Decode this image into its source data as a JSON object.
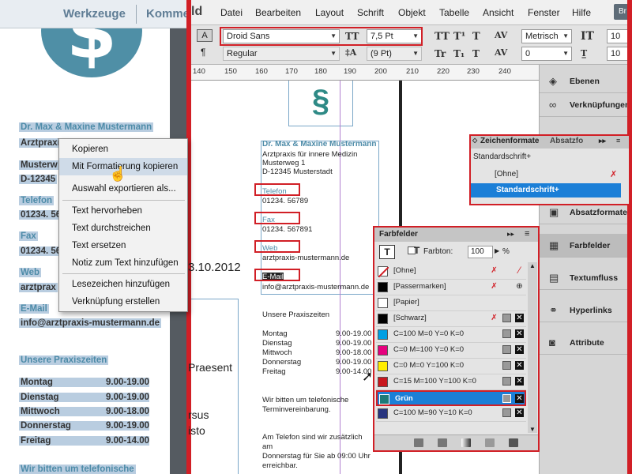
{
  "left_panel": {
    "workspace_1": "Werkzeuge",
    "workspace_2": "Komme",
    "logo_glyph": "$",
    "lines": [
      {
        "text": "Dr. Max & Maxine Mustermann",
        "style": "title"
      },
      {
        "text": "Arztpraxis",
        "style": "plain"
      },
      {
        "text": "Musterw",
        "style": "plain"
      },
      {
        "text": "D-12345",
        "style": "plain"
      },
      {
        "text": "Telefon",
        "style": "head"
      },
      {
        "text": "01234. 56",
        "style": "plain"
      },
      {
        "text": "Fax",
        "style": "head"
      },
      {
        "text": "01234. 56",
        "style": "plain"
      },
      {
        "text": "Web",
        "style": "head"
      },
      {
        "text": "arztprax",
        "style": "plain"
      },
      {
        "text": "E-Mail",
        "style": "head"
      },
      {
        "text": "info@arztpraxis-mustermann.de",
        "style": "plain"
      },
      {
        "text": "Unsere Praxiszeiten",
        "style": "head"
      }
    ],
    "hours": [
      {
        "day": "Montag",
        "time": "9.00-19.00"
      },
      {
        "day": "Dienstag",
        "time": "9.00-19.00"
      },
      {
        "day": "Mittwoch",
        "time": "9.00-18.00"
      },
      {
        "day": "Donnerstag",
        "time": "9.00-19.00"
      },
      {
        "day": "Freitag",
        "time": "9.00-14.00"
      }
    ],
    "footer_text": "Wir bitten um telefonische"
  },
  "menubar": {
    "app_fragment": "ld",
    "items": [
      "Datei",
      "Bearbeiten",
      "Layout",
      "Schrift",
      "Objekt",
      "Tabelle",
      "Ansicht",
      "Fenster",
      "Hilfe"
    ],
    "bridge": "Br"
  },
  "control_panel": {
    "font_family": "Droid Sans",
    "font_style": "Regular",
    "font_size": "7,5 Pt",
    "leading": "(9 Pt)",
    "kerning": "Metrisch",
    "tracking": "0",
    "scale_vertical": "10",
    "scale_horizontal": "10",
    "char_mode_label": "A",
    "para_mode_label": "¶"
  },
  "ruler": {
    "ticks": [
      "140",
      "150",
      "160",
      "170",
      "180",
      "190",
      "200",
      "210",
      "220",
      "230",
      "240"
    ]
  },
  "document": {
    "logo_glyph": "§",
    "title": "Dr. Max & Maxine Mustermann",
    "address": [
      "Arztpraxis für innere Medizin",
      "Musterweg 1",
      "D-12345 Musterstadt"
    ],
    "telefon_label": "Telefon",
    "telefon": "01234. 56789",
    "fax_label": "Fax",
    "fax": "01234. 567891",
    "web_label": "Web",
    "web": "arztpraxis-mustermann.de",
    "email_label": "E-Mail",
    "email": "info@arztpraxis-mustermann.de",
    "hours_title": "Unsere Praxiszeiten",
    "hours": [
      {
        "day": "Montag",
        "time": "9.00-19.00"
      },
      {
        "day": "Dienstag",
        "time": "9.00-19.00"
      },
      {
        "day": "Mittwoch",
        "time": "9.00-18.00"
      },
      {
        "day": "Donnerstag",
        "time": "9.00-19.00"
      },
      {
        "day": "Freitag",
        "time": "9.00-14.00"
      }
    ],
    "note_lines": [
      "Wir bitten um telefonische",
      "Terminvereinbarung."
    ],
    "phone_note_lines": [
      "Am Telefon sind wir zusätzlich",
      "am",
      "Donnerstag für Sie ab 09:00 Uhr",
      "erreichbar."
    ]
  },
  "floating_text": {
    "date": "3.10.2012",
    "word_1": "Praesent",
    "word_2": "rsus",
    "word_3": "isto"
  },
  "context_menu": {
    "items": [
      {
        "label": "Kopieren",
        "highlight": false
      },
      {
        "label": "Mit Formatierung kopieren",
        "highlight": true
      },
      {
        "label": "Auswahl exportieren als...",
        "highlight": false
      },
      {
        "label": "Text hervorheben",
        "highlight": false
      },
      {
        "label": "Text durchstreichen",
        "highlight": false
      },
      {
        "label": "Text ersetzen",
        "highlight": false
      },
      {
        "label": "Notiz zum Text hinzufügen",
        "highlight": false
      },
      {
        "label": "Lesezeichen hinzufügen",
        "highlight": false
      },
      {
        "label": "Verknüpfung erstellen",
        "highlight": false
      }
    ]
  },
  "dock": {
    "items": [
      {
        "label": "Ebenen",
        "icon": "layers-icon"
      },
      {
        "label": "Verknüpfungen",
        "icon": "links-icon"
      },
      {
        "label": "Absatzformate",
        "icon": "paragraph-styles-icon"
      },
      {
        "label": "Farbfelder",
        "icon": "swatches-icon"
      },
      {
        "label": "Textumfluss",
        "icon": "text-wrap-icon"
      },
      {
        "label": "Hyperlinks",
        "icon": "hyperlinks-icon"
      },
      {
        "label": "Attribute",
        "icon": "attributes-icon"
      }
    ]
  },
  "zeichenformate_panel": {
    "tab_1": "Zeichenformate",
    "tab_2": "Absatzfo",
    "current_style": "Standardschrift+",
    "items": [
      "[Ohne]",
      "Standardschrift+"
    ]
  },
  "farbfelder_panel": {
    "title": "Farbfelder",
    "tint_label": "Farbton:",
    "tint_value": "100",
    "tint_unit": "%",
    "swatches": [
      {
        "name": "[Ohne]",
        "color": "#ffffff",
        "selected": false
      },
      {
        "name": "[Passermarken]",
        "color": "#000000",
        "selected": false
      },
      {
        "name": "[Papier]",
        "color": "#ffffff",
        "selected": false
      },
      {
        "name": "[Schwarz]",
        "color": "#000000",
        "selected": false
      },
      {
        "name": "C=100 M=0 Y=0 K=0",
        "color": "#009fe3",
        "selected": false
      },
      {
        "name": "C=0 M=100 Y=0 K=0",
        "color": "#e6007e",
        "selected": false
      },
      {
        "name": "C=0 M=0 Y=100 K=0",
        "color": "#ffed00",
        "selected": false
      },
      {
        "name": "C=15 M=100 Y=100 K=0",
        "color": "#c8171e",
        "selected": false
      },
      {
        "name": "Grün",
        "color": "#1e7a78",
        "selected": true
      },
      {
        "name": "C=100 M=90 Y=10 K=0",
        "color": "#29357f",
        "selected": false
      }
    ]
  },
  "colors": {
    "accent_red": "#d11f26",
    "selection_blue": "#1b7fd7",
    "brand_teal": "#4d8ba8"
  }
}
